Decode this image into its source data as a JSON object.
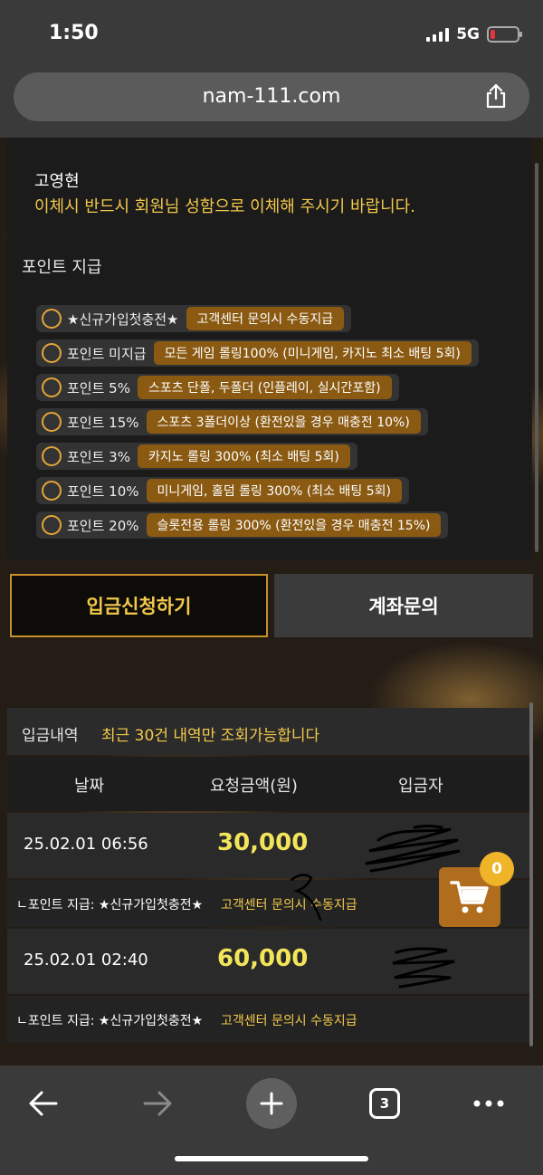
{
  "status": {
    "time": "1:50",
    "network": "5G"
  },
  "browser": {
    "url": "nam-111.com",
    "tab_count": "3"
  },
  "account": {
    "name": "고영현",
    "notice": "이체시 반드시 회원님 성함으로 이체해 주시기 바랍니다."
  },
  "points": {
    "title": "포인트 지급",
    "options": [
      {
        "label": "★신규가입첫충전★",
        "desc": "고객센터 문의시 수동지급"
      },
      {
        "label": "포인트 미지급",
        "desc": "모든 게임 롤링100% (미니게임, 카지노 최소 배팅 5회)"
      },
      {
        "label": "포인트 5%",
        "desc": "스포츠 단폴, 두폴더 (인플레이, 실시간포함)"
      },
      {
        "label": "포인트 15%",
        "desc": "스포츠 3폴더이상 (환전있을 경우 매충전 10%)"
      },
      {
        "label": "포인트 3%",
        "desc": "카지노 롤링 300% (최소 배팅 5회)"
      },
      {
        "label": "포인트 10%",
        "desc": "미니게임, 홀덤 롤링 300% (최소 배팅 5회)"
      },
      {
        "label": "포인트 20%",
        "desc": "슬롯전용 롤링 300% (환전있을 경우 매충전 15%)"
      }
    ]
  },
  "buttons": {
    "apply": "입금신청하기",
    "account_inquiry": "계좌문의"
  },
  "history": {
    "title": "입금내역",
    "note": "최근 30건 내역만 조회가능합니다",
    "columns": [
      "날짜",
      "요청금액(원)",
      "입금자"
    ],
    "rows": [
      {
        "date": "25.02.01 06:56",
        "amount": "30,000",
        "point_label": "ㄴ포인트 지급: ★신규가입첫충전★",
        "point_desc": "고객센터 문의시 수동지급"
      },
      {
        "date": "25.02.01 02:40",
        "amount": "60,000",
        "point_label": "ㄴ포인트 지급: ★신규가입첫충전★",
        "point_desc": "고객센터 문의시 수동지급"
      }
    ]
  },
  "cart": {
    "count": "0"
  },
  "colors": {
    "accent_gold": "#f3c94b",
    "button_brown": "#8a5a12",
    "amount_yellow": "#f3e55a"
  }
}
